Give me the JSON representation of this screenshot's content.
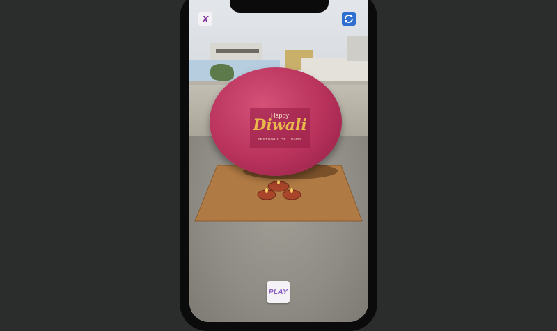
{
  "app": {
    "close_label": "X",
    "play_label": "PLAY",
    "icons": {
      "close": "close-icon",
      "switch_camera": "camera-switch-icon"
    }
  },
  "scene": {
    "banner": {
      "happy": "Happy",
      "title": "Diwali",
      "subtitle": "FESTIVALS OF LIGHTS"
    },
    "colors": {
      "balloon": "#b8325c",
      "banner_gold": "#e8b84a",
      "mat": "#b07a44",
      "accent_purple": "#8a5cc4"
    }
  }
}
